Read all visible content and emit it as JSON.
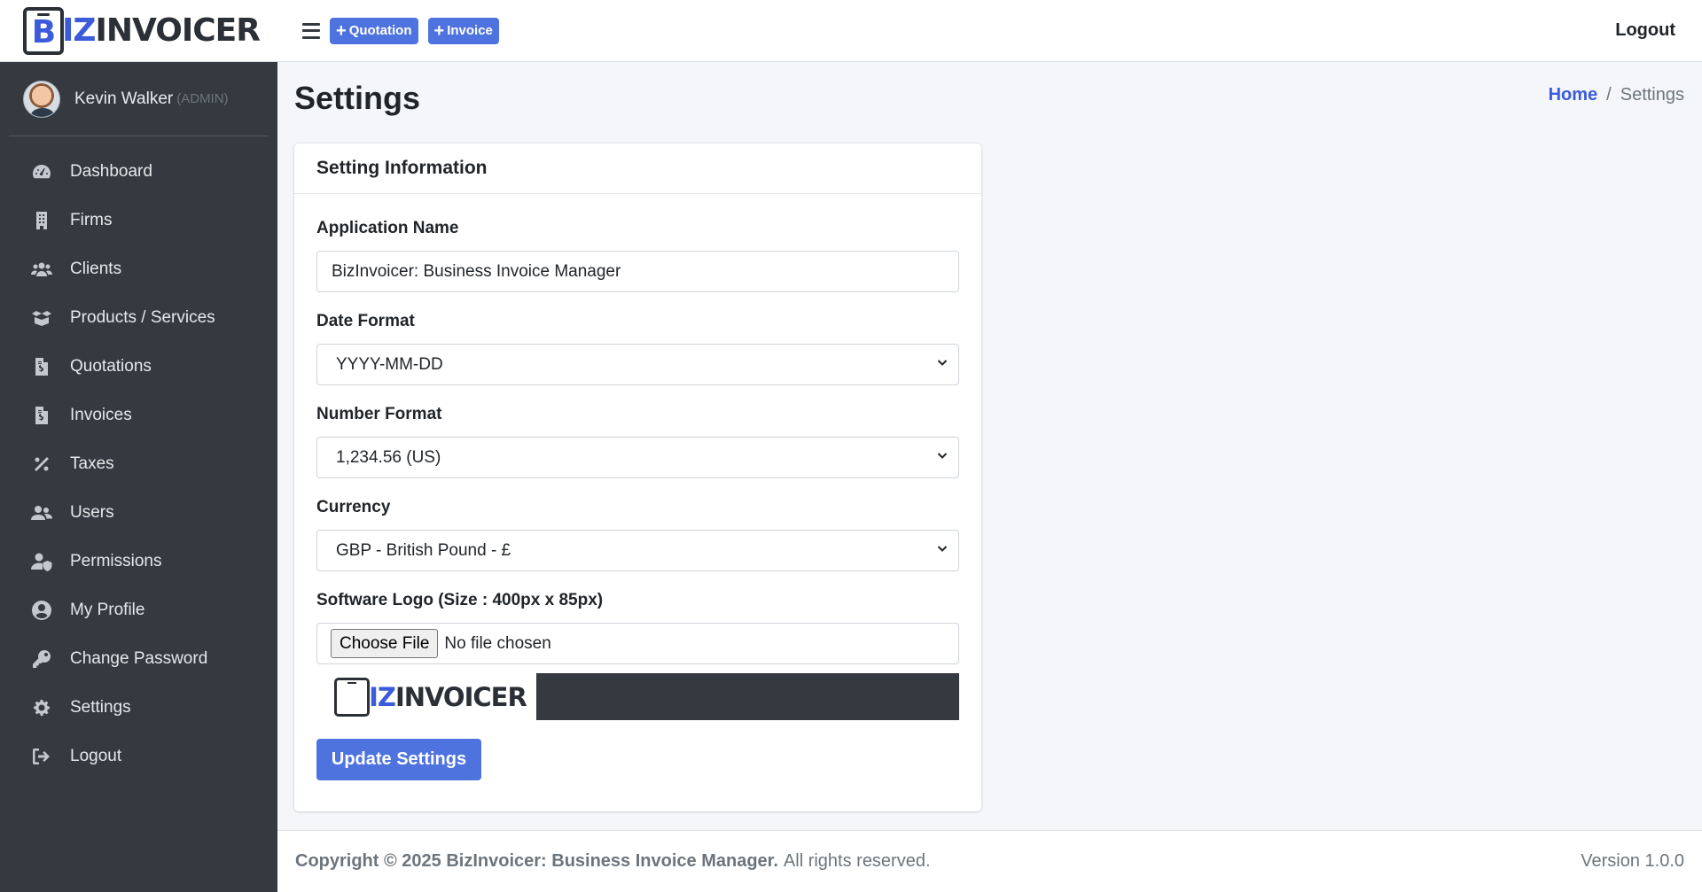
{
  "brand": {
    "b": "B",
    "z": "Z",
    "rest": "INVOICER",
    "i": "I"
  },
  "user": {
    "name": "Kevin Walker",
    "role": "(ADMIN)"
  },
  "sidebar": {
    "items": [
      {
        "label": "Dashboard",
        "icon": "tachometer-icon"
      },
      {
        "label": "Firms",
        "icon": "building-icon"
      },
      {
        "label": "Clients",
        "icon": "users-icon"
      },
      {
        "label": "Products / Services",
        "icon": "box-open-icon"
      },
      {
        "label": "Quotations",
        "icon": "file-invoice-icon"
      },
      {
        "label": "Invoices",
        "icon": "file-invoice-dollar-icon"
      },
      {
        "label": "Taxes",
        "icon": "percent-icon"
      },
      {
        "label": "Users",
        "icon": "user-friends-icon"
      },
      {
        "label": "Permissions",
        "icon": "user-shield-icon"
      },
      {
        "label": "My Profile",
        "icon": "user-circle-icon"
      },
      {
        "label": "Change Password",
        "icon": "key-icon"
      },
      {
        "label": "Settings",
        "icon": "gear-icon"
      },
      {
        "label": "Logout",
        "icon": "sign-out-icon"
      }
    ]
  },
  "topbar": {
    "quotation_label": "Quotation",
    "invoice_label": "Invoice",
    "logout_label": "Logout"
  },
  "page": {
    "title": "Settings",
    "breadcrumb_home": "Home",
    "breadcrumb_sep": "/",
    "breadcrumb_current": "Settings"
  },
  "card": {
    "title": "Setting Information",
    "app_name_label": "Application Name",
    "app_name_value": "BizInvoicer: Business Invoice Manager",
    "date_format_label": "Date Format",
    "date_format_value": "YYYY-MM-DD",
    "number_format_label": "Number Format",
    "number_format_value": "1,234.56 (US)",
    "currency_label": "Currency",
    "currency_value": "GBP - British Pound - £",
    "logo_label": "Software Logo (Size : 400px x 85px)",
    "file_button": "Choose File",
    "file_status": "No file chosen",
    "submit_label": "Update Settings"
  },
  "footer": {
    "copyright": "Copyright © 2025 BizInvoicer: Business Invoice Manager.",
    "rights": "All rights reserved.",
    "version": "Version 1.0.0"
  },
  "colors": {
    "primary": "#4e73df",
    "sidebar_bg": "#343a40",
    "logo_blue": "#3b5bdb"
  }
}
